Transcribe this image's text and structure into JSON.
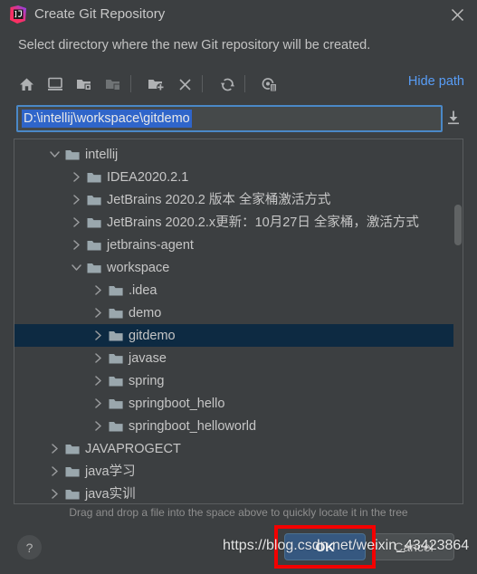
{
  "window": {
    "title": "Create Git Repository",
    "app_icon": "intellij-idea-icon",
    "close_icon": "close-icon",
    "subtitle": "Select directory where the new Git repository will be created."
  },
  "toolbar": {
    "buttons": [
      {
        "name": "home-icon",
        "title": "Home",
        "disabled": false
      },
      {
        "name": "desktop-icon",
        "title": "Desktop",
        "disabled": false
      },
      {
        "name": "project-folder-icon",
        "title": "Project Directory",
        "disabled": false
      },
      {
        "name": "module-folder-icon",
        "title": "Module Directory",
        "disabled": true
      },
      {
        "name": "new-folder-icon",
        "title": "New Folder",
        "disabled": false
      },
      {
        "name": "delete-icon",
        "title": "Delete",
        "disabled": false
      },
      {
        "name": "refresh-icon",
        "title": "Refresh",
        "disabled": false
      },
      {
        "name": "show-hidden-files-icon",
        "title": "Show Hidden Files",
        "disabled": false
      }
    ],
    "hide_path_label": "Hide path"
  },
  "path_field": {
    "value": "D:\\intellij\\workspace\\gitdemo",
    "placeholder": "",
    "selected": true,
    "dropdown_icon": "dropdown-arrow-icon"
  },
  "tree": {
    "rows": [
      {
        "label": "intellij",
        "indent": 38,
        "state": "expanded",
        "selected": false
      },
      {
        "label": "IDEA2020.2.1",
        "indent": 62,
        "state": "collapsed",
        "selected": false
      },
      {
        "label": "JetBrains 2020.2 版本 全家桶激活方式",
        "indent": 62,
        "state": "collapsed",
        "selected": false
      },
      {
        "label": "JetBrains 2020.2.x更新：10月27日 全家桶，激活方式",
        "indent": 62,
        "state": "collapsed",
        "selected": false
      },
      {
        "label": "jetbrains-agent",
        "indent": 62,
        "state": "collapsed",
        "selected": false
      },
      {
        "label": "workspace",
        "indent": 62,
        "state": "expanded",
        "selected": false
      },
      {
        "label": ".idea",
        "indent": 86,
        "state": "collapsed",
        "selected": false
      },
      {
        "label": "demo",
        "indent": 86,
        "state": "collapsed",
        "selected": false
      },
      {
        "label": "gitdemo",
        "indent": 86,
        "state": "collapsed",
        "selected": true
      },
      {
        "label": "javase",
        "indent": 86,
        "state": "collapsed",
        "selected": false
      },
      {
        "label": "spring",
        "indent": 86,
        "state": "collapsed",
        "selected": false
      },
      {
        "label": "springboot_hello",
        "indent": 86,
        "state": "collapsed",
        "selected": false
      },
      {
        "label": "springboot_helloworld",
        "indent": 86,
        "state": "collapsed",
        "selected": false
      },
      {
        "label": "JAVAPROGECT",
        "indent": 38,
        "state": "collapsed",
        "selected": false
      },
      {
        "label": "java学习",
        "indent": 38,
        "state": "collapsed",
        "selected": false
      },
      {
        "label": "java实训",
        "indent": 38,
        "state": "collapsed",
        "selected": false
      }
    ]
  },
  "hint": "Drag and drop a file into the space above to quickly locate it in the tree",
  "footer": {
    "help_label": "?",
    "ok_label": "OK",
    "cancel_label": "Cancel"
  },
  "annotation": {
    "watermark": "https://blog.csdn.net/weixin_43423864",
    "highlight_color": "#f40000",
    "highlight_target": "ok-button"
  },
  "colors": {
    "dialog_bg": "#3c3f41",
    "selection_bg": "#0d2a42",
    "accent_link": "#589df6",
    "ok_button_bg": "#365880",
    "path_selection_bg": "#2f65ca",
    "focus_border": "#4a88c7"
  }
}
